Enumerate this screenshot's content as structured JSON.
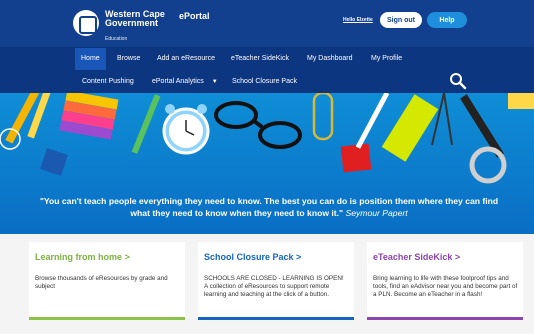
{
  "header": {
    "org_line1": "Western Cape",
    "org_line2": "Government",
    "dept": "Education",
    "brand": "ePortal",
    "greeting": "Hello Elzette",
    "signout_label": "Sign out",
    "help_label": "Help"
  },
  "nav": {
    "primary": [
      {
        "label": "Home",
        "active": true
      },
      {
        "label": "Browse"
      },
      {
        "label": "Add an eResource"
      },
      {
        "label": "eTeacher SideKick"
      },
      {
        "label": "My Dashboard"
      },
      {
        "label": "My Profile"
      }
    ],
    "secondary": [
      {
        "label": "Content Pushing"
      },
      {
        "label": "ePortal Analytics",
        "dropdown": true
      },
      {
        "label": "School Closure Pack"
      }
    ],
    "search_icon": "search-icon"
  },
  "hero": {
    "quote": "\"You can't teach people everything they need to know. The best you can do is position them where they can find what they need to know when they need to know it.\"",
    "author": "Seymour Papert",
    "background": "#0f8ed6"
  },
  "cards": [
    {
      "title": "Learning from home >",
      "body": "Browse thousands of eResources by grade and subject",
      "accent": "#7cb342"
    },
    {
      "title": "School Closure Pack >",
      "body": "SCHOOLS ARE CLOSED - LEARNING IS OPEN! A collection of eResources to support remote learning and teaching at the click of a button.",
      "accent": "#1565c0"
    },
    {
      "title": "eTeacher SideKick >",
      "body": "Bring learning to life with these foolproof tips and tools, find an eAdvisor near you and become part of a PLN. Become an eTeacher in a flash!",
      "accent": "#8e44ad"
    }
  ]
}
